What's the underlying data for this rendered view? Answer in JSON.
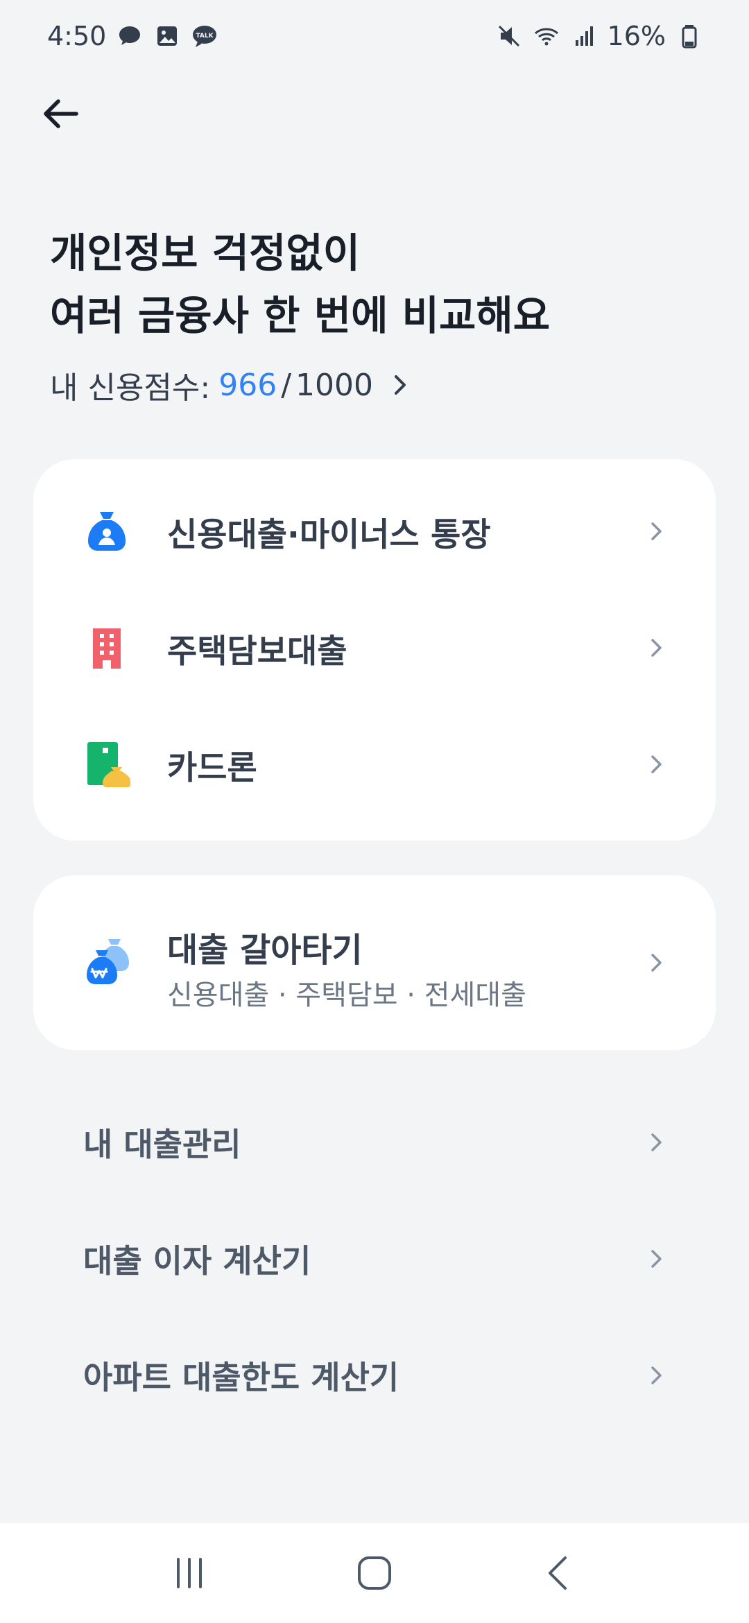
{
  "status_bar": {
    "time": "4:50",
    "battery": "16%",
    "left_icons": [
      "chat-bubble-icon",
      "image-icon",
      "talk-icon"
    ],
    "right_icons": [
      "mute-icon",
      "wifi-icon",
      "signal-icon",
      "battery-icon"
    ]
  },
  "header": {
    "back_icon": "arrow-left-icon"
  },
  "headline": {
    "line1": "개인정보 걱정없이",
    "line2": "여러 금융사 한 번에 비교해요"
  },
  "credit_score": {
    "label": "내 신용점수:",
    "value": "966",
    "separator": "/",
    "max": "1000"
  },
  "loan_products": [
    {
      "label": "신용대출·마이너스 통장",
      "icon": "money-bag-person-icon",
      "color": "#1b7cf5"
    },
    {
      "label": "주택담보대출",
      "icon": "building-icon",
      "color": "#f0616b"
    },
    {
      "label": "카드론",
      "icon": "card-coin-icon",
      "color": "#15b36b"
    }
  ],
  "refinance": {
    "title": "대출 갈아타기",
    "subtitle": "신용대출 · 주택담보 · 전세대출",
    "icon": "won-bag-icon"
  },
  "menu_items": [
    {
      "label": "내 대출관리"
    },
    {
      "label": "대출 이자 계산기"
    },
    {
      "label": "아파트 대출한도 계산기"
    }
  ],
  "nav_bar": {
    "items": [
      "recents-icon",
      "home-icon",
      "back-icon"
    ]
  },
  "colors": {
    "accent": "#3182f6",
    "background": "#f2f4f6",
    "card": "#ffffff"
  }
}
